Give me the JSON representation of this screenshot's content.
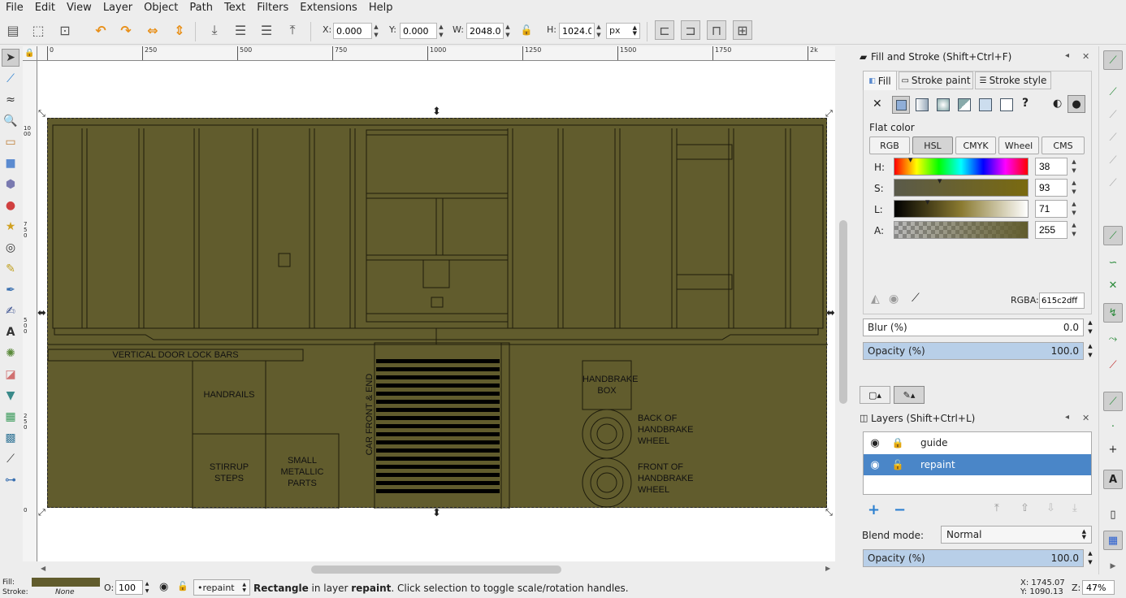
{
  "menu": [
    "File",
    "Edit",
    "View",
    "Layer",
    "Object",
    "Path",
    "Text",
    "Filters",
    "Extensions",
    "Help"
  ],
  "toolbar": {
    "x_label": "X:",
    "x_value": "0.000",
    "y_label": "Y:",
    "y_value": "0.000",
    "w_label": "W:",
    "w_value": "2048.00",
    "h_label": "H:",
    "h_value": "1024.00",
    "unit": "px"
  },
  "ruler": {
    "h_ticks": [
      "0",
      "250",
      "500",
      "750",
      "1000",
      "1250",
      "1500",
      "1750",
      "2k"
    ],
    "v_ticks": [
      "1000",
      "750",
      "500",
      "250",
      "0"
    ]
  },
  "canvas": {
    "door_lock_label": "VERTICAL DOOR LOCK BARS",
    "handrails_label": "HANDRAILS",
    "stirrup_label": "STIRRUP STEPS",
    "small_parts_label": "SMALL METALLIC PARTS",
    "car_front_label": "CAR FRONT & END",
    "handbrake_box_label": "HANDBRAKE BOX",
    "back_wheel_label": "BACK OF HANDBRAKE WHEEL",
    "front_wheel_label": "FRONT OF HANDBRAKE WHEEL",
    "fill_color": "#615c2d"
  },
  "fill_stroke": {
    "title": "Fill and Stroke (Shift+Ctrl+F)",
    "tabs": [
      "Fill",
      "Stroke paint",
      "Stroke style"
    ],
    "mode_label": "Flat color",
    "color_modes": [
      "RGB",
      "HSL",
      "CMYK",
      "Wheel",
      "CMS"
    ],
    "active_mode": "HSL",
    "h_label": "H:",
    "h_value": "38",
    "s_label": "S:",
    "s_value": "93",
    "l_label": "L:",
    "l_value": "71",
    "a_label": "A:",
    "a_value": "255",
    "rgba_label": "RGBA:",
    "rgba_value": "615c2dff",
    "blur_label": "Blur (%)",
    "blur_value": "0.0",
    "opacity_label": "Opacity (%)",
    "opacity_value": "100.0"
  },
  "layers": {
    "title": "Layers (Shift+Ctrl+L)",
    "items": [
      {
        "name": "guide",
        "selected": false
      },
      {
        "name": "repaint",
        "selected": true
      }
    ],
    "blend_label": "Blend mode:",
    "blend_value": "Normal",
    "opacity_label": "Opacity (%)",
    "opacity_value": "100.0"
  },
  "status": {
    "fill_label": "Fill:",
    "stroke_label": "Stroke:",
    "stroke_value": "None",
    "opacity_label": "O:",
    "opacity_value": "100",
    "layer_value": "•repaint",
    "msg_object": "Rectangle",
    "msg_mid": " in layer ",
    "msg_layer": "repaint",
    "msg_tail": ". Click selection to toggle scale/rotation handles.",
    "cursor_x": "X: 1745.07",
    "cursor_y": "Y: 1090.13",
    "zoom_label": "Z:",
    "zoom_value": "47%"
  },
  "colors": {
    "selected_row": "#4a86c8",
    "accent": "#e8901a",
    "canvas_fill": "#615c2d"
  }
}
